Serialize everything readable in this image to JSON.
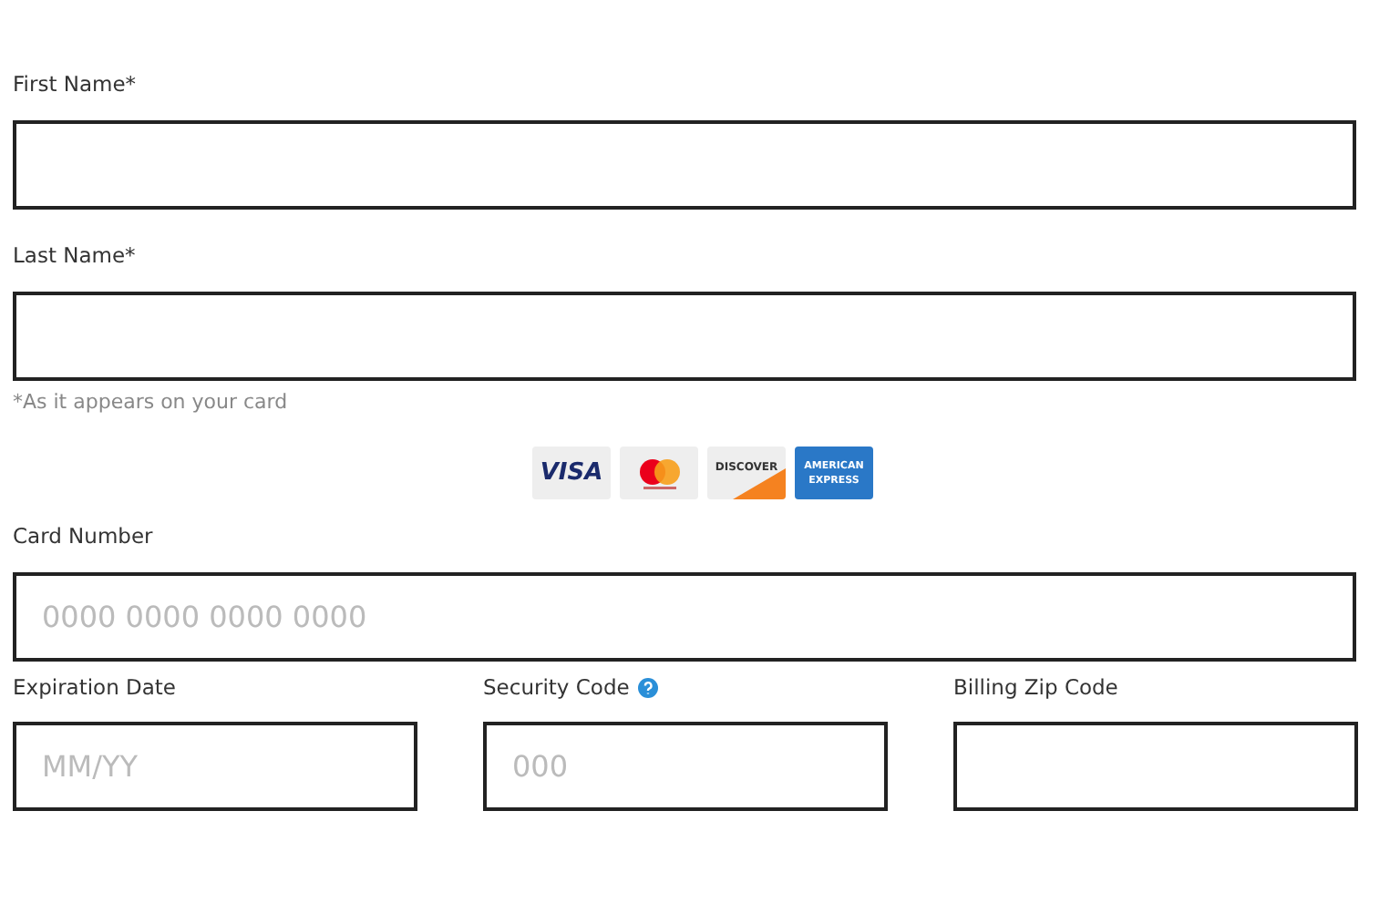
{
  "fields": [
    {
      "label": "First Name*"
    },
    {
      "label": "Last Name*"
    }
  ],
  "name_hint": "*As it appears on your card",
  "cards": [
    {
      "kind": "visa",
      "text": "VISA"
    },
    {
      "kind": "mastercard"
    },
    {
      "kind": "discover",
      "text": "DISCOVER"
    },
    {
      "kind": "amex",
      "text": "AMERICAN EXPRESS"
    }
  ],
  "card_number": {
    "label": "Card Number",
    "placeholder": "0000 0000 0000 0000"
  },
  "row_fields": [
    {
      "label": "Expiration Date",
      "placeholder": "MM/YY",
      "help": false
    },
    {
      "label": "Security Code",
      "placeholder": "000",
      "help": true
    },
    {
      "label": "Billing Zip Code",
      "help": false
    }
  ]
}
